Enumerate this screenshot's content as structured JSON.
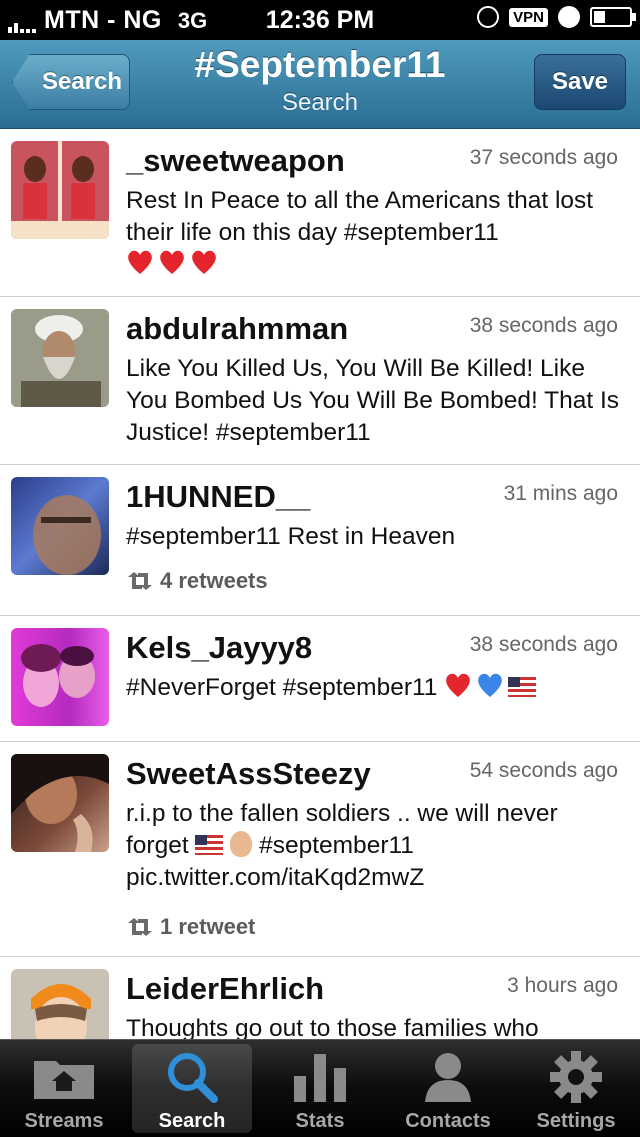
{
  "status_bar": {
    "carrier": "MTN - NG",
    "network": "3G",
    "time": "12:36 PM",
    "vpn": "VPN"
  },
  "nav": {
    "back_label": "Search",
    "title": "#September11",
    "subtitle": "Search",
    "save_label": "Save"
  },
  "tweets": [
    {
      "username": "_sweetweapon",
      "time": "37 seconds ago",
      "text": "Rest In Peace to all the Americans that lost their life on this day #september11"
    },
    {
      "username": "abdulrahmman",
      "time": "38 seconds ago",
      "text": "Like You Killed Us, You Will Be Killed! Like You Bombed Us You Will Be Bombed! That Is Justice! #september11"
    },
    {
      "username": "1HUNNED__",
      "time": "31 mins ago",
      "text": "#september11 Rest in Heaven",
      "retweets": "4 retweets"
    },
    {
      "username": "Kels_Jayyy8",
      "time": "38 seconds ago",
      "text": "#NeverForget #september11"
    },
    {
      "username": "SweetAssSteezy",
      "time": "54 seconds ago",
      "text_1": "r.i.p to the fallen soldiers .. we will never forget",
      "text_2": "#september11 pic.twitter.com/itaKqd2mwZ",
      "retweets": "1 retweet"
    },
    {
      "username": "LeiderEhrlich",
      "time": "3 hours ago",
      "text": "Thoughts go out to those families who"
    }
  ],
  "tabs": [
    {
      "label": "Streams",
      "icon": "home-folder-icon"
    },
    {
      "label": "Search",
      "icon": "search-icon",
      "active": true
    },
    {
      "label": "Stats",
      "icon": "stats-icon"
    },
    {
      "label": "Contacts",
      "icon": "contact-icon"
    },
    {
      "label": "Settings",
      "icon": "gear-icon"
    }
  ],
  "colors": {
    "nav_top": "#4f9bbd",
    "nav_bottom": "#2a6d93",
    "save_button": "#1b4872",
    "tab_active": "#2f8fd8"
  }
}
